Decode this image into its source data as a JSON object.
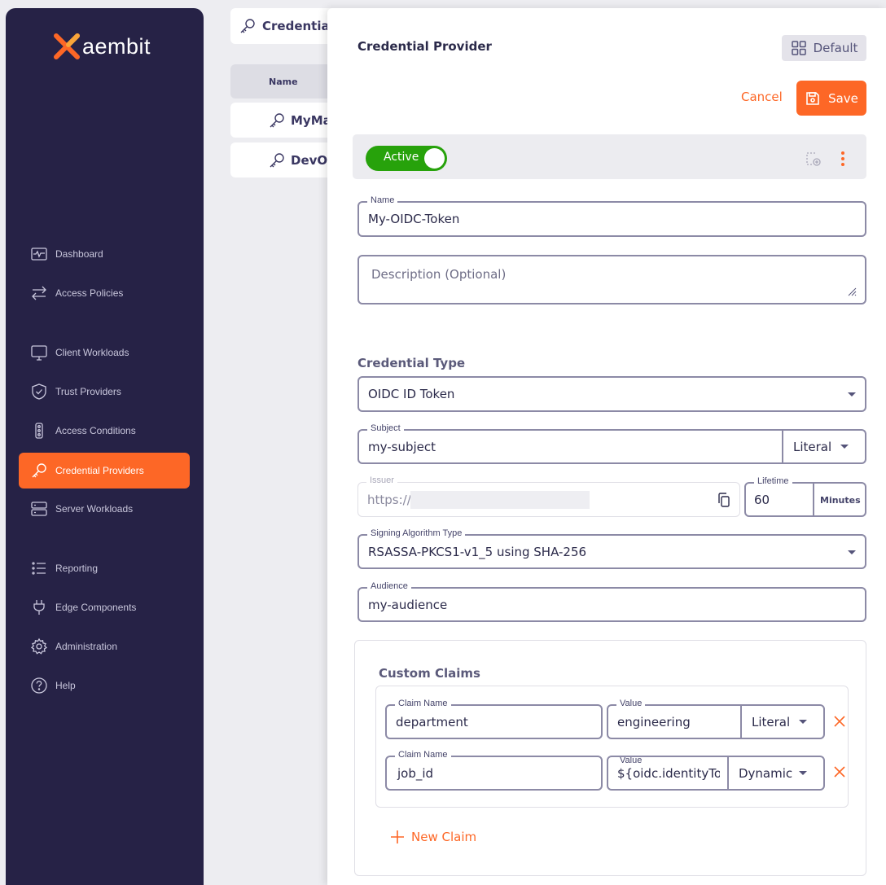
{
  "brand": {
    "logo_text": "aembit",
    "accent": "#fd6726",
    "sidebar_bg": "#262246"
  },
  "sidebar": {
    "items": [
      {
        "label": "Dashboard",
        "icon": "dashboard-icon"
      },
      {
        "label": "Access Policies",
        "icon": "arrows-icon"
      },
      {
        "label": "Client Workloads",
        "icon": "monitor-icon"
      },
      {
        "label": "Trust Providers",
        "icon": "shield-icon"
      },
      {
        "label": "Access Conditions",
        "icon": "traffic-light-icon"
      },
      {
        "label": "Credential Providers",
        "icon": "key-icon",
        "active": true
      },
      {
        "label": "Server Workloads",
        "icon": "server-icon"
      },
      {
        "label": "Reporting",
        "icon": "list-icon"
      },
      {
        "label": "Edge Components",
        "icon": "plug-icon"
      },
      {
        "label": "Administration",
        "icon": "gear-icon"
      },
      {
        "label": "Help",
        "icon": "help-icon"
      }
    ]
  },
  "background_page": {
    "title": "Credential",
    "column_header": "Name",
    "rows": [
      "MyMa",
      "DevOp"
    ]
  },
  "panel": {
    "title": "Credential Provider",
    "default_label": "Default",
    "cancel_label": "Cancel",
    "save_label": "Save",
    "status_label": "Active",
    "name": {
      "label": "Name",
      "value": "My-OIDC-Token"
    },
    "description": {
      "placeholder": "Description (Optional)"
    },
    "credential_type": {
      "heading": "Credential Type",
      "value": "OIDC ID Token"
    },
    "subject": {
      "label": "Subject",
      "value": "my-subject",
      "mode": "Literal"
    },
    "issuer": {
      "label": "Issuer",
      "value": "https://"
    },
    "lifetime": {
      "label": "Lifetime",
      "value": "60",
      "unit": "Minutes"
    },
    "signing_algorithm": {
      "label": "Signing Algorithm Type",
      "value": "RSASSA-PKCS1-v1_5 using SHA-256"
    },
    "audience": {
      "label": "Audience",
      "value": "my-audience"
    },
    "custom_claims": {
      "heading": "Custom Claims",
      "claims": [
        {
          "name_label": "Claim Name",
          "name": "department",
          "value_label": "Value",
          "value": "engineering",
          "mode": "Literal"
        },
        {
          "name_label": "Claim Name",
          "name": "job_id",
          "value_label": "Value",
          "value": "${oidc.identityTok",
          "mode": "Dynamic"
        }
      ],
      "new_claim_label": "New Claim"
    }
  }
}
